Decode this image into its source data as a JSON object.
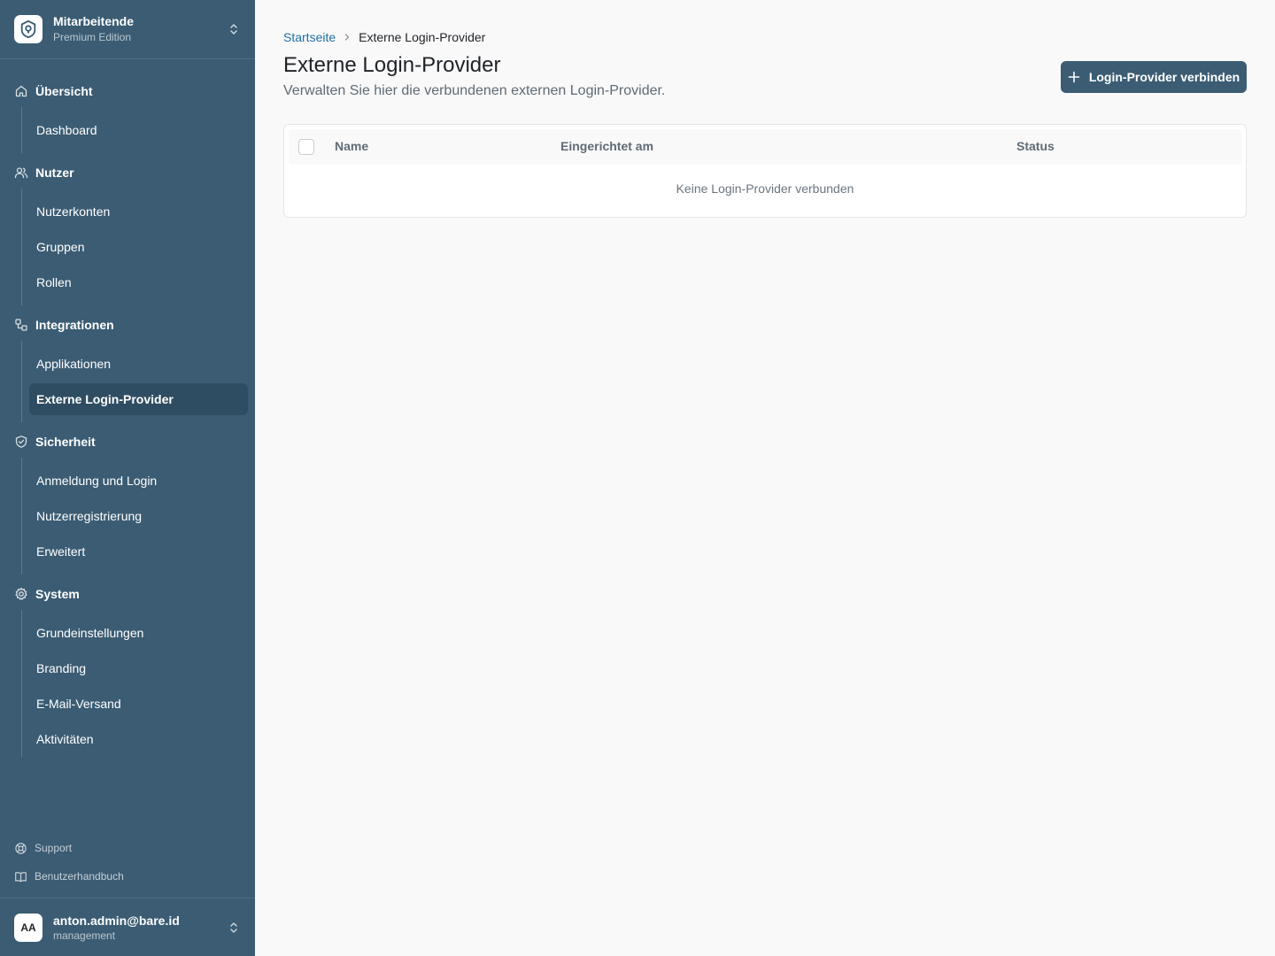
{
  "org": {
    "name": "Mitarbeitende",
    "edition": "Premium Edition"
  },
  "nav": {
    "sections": [
      {
        "label": "Übersicht",
        "icon": "home-icon",
        "items": [
          "Dashboard"
        ]
      },
      {
        "label": "Nutzer",
        "icon": "users-icon",
        "items": [
          "Nutzerkonten",
          "Gruppen",
          "Rollen"
        ]
      },
      {
        "label": "Integrationen",
        "icon": "integrations-icon",
        "items": [
          "Applikationen",
          "Externe Login-Provider"
        ]
      },
      {
        "label": "Sicherheit",
        "icon": "shield-check-icon",
        "items": [
          "Anmeldung und Login",
          "Nutzerregistrierung",
          "Erweitert"
        ]
      },
      {
        "label": "System",
        "icon": "gear-icon",
        "items": [
          "Grundeinstellungen",
          "Branding",
          "E-Mail-Versand",
          "Aktivitäten"
        ]
      }
    ],
    "active_item": "Externe Login-Provider"
  },
  "footer_links": {
    "support": "Support",
    "manual": "Benutzerhandbuch"
  },
  "user": {
    "initials": "AA",
    "email": "anton.admin@bare.id",
    "role": "management"
  },
  "breadcrumb": {
    "home": "Startseite",
    "current": "Externe Login-Provider"
  },
  "page": {
    "title": "Externe Login-Provider",
    "subtitle": "Verwalten Sie hier die verbundenen externen Login-Provider.",
    "primary_action": "Login-Provider verbinden"
  },
  "table": {
    "columns": [
      "Name",
      "Eingerichtet am",
      "Status"
    ],
    "empty_message": "Keine Login-Provider verbunden"
  },
  "colors": {
    "sidebar": "#3b5c73",
    "sidebar_active": "#2f4d62",
    "link": "#1f6fa3",
    "primary_button": "#3b5c73"
  }
}
